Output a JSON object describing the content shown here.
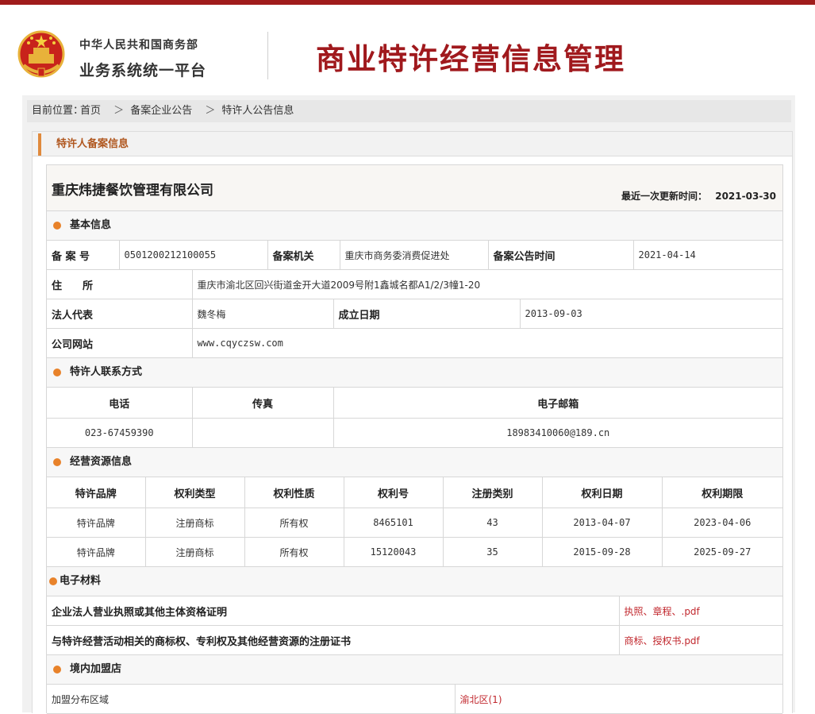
{
  "header": {
    "ministry_line1": "中华人民共和国商务部",
    "ministry_line2": "业务系统统一平台",
    "system_title": "商业特许经营信息管理"
  },
  "breadcrumb": {
    "prefix": "目前位置：",
    "items": [
      "首页",
      "备案企业公告",
      "特许人公告信息"
    ],
    "separator": "＞"
  },
  "panel": {
    "title": "特许人备案信息"
  },
  "company": {
    "name": "重庆炜捷餐饮管理有限公司",
    "last_update_label": "最近一次更新时间：",
    "last_update": "2021-03-30"
  },
  "basic": {
    "title": "基本信息",
    "record_no_label": "备 案 号",
    "record_no": "0501200212100055",
    "authority_label": "备案机关",
    "authority": "重庆市商务委消费促进处",
    "announce_label": "备案公告时间",
    "announce_date": "2021-04-14",
    "address_label": "住　　所",
    "address": "重庆市渝北区回兴街道金开大道2009号附1鑫城名都A1/2/3幢1-20",
    "legal_rep_label": "法人代表",
    "legal_rep": "魏冬梅",
    "founded_label": "成立日期",
    "founded": "2013-09-03",
    "website_label": "公司网站",
    "website": "www.cqyczsw.com"
  },
  "contact": {
    "title": "特许人联系方式",
    "headers": [
      "电话",
      "传真",
      "电子邮箱"
    ],
    "phone": "023-67459390",
    "fax": "",
    "email": "18983410060@189.cn"
  },
  "resources": {
    "title": "经营资源信息",
    "headers": [
      "特许品牌",
      "权利类型",
      "权利性质",
      "权利号",
      "注册类别",
      "权利日期",
      "权利期限"
    ],
    "rows": [
      [
        "特许品牌",
        "注册商标",
        "所有权",
        "8465101",
        "43",
        "2013-04-07",
        "2023-04-06"
      ],
      [
        "特许品牌",
        "注册商标",
        "所有权",
        "15120043",
        "35",
        "2015-09-28",
        "2025-09-27"
      ]
    ]
  },
  "materials": {
    "title": "电子材料",
    "rows": [
      {
        "label": "企业法人营业执照或其他主体资格证明",
        "file": "执照、章程、.pdf"
      },
      {
        "label": "与特许经营活动相关的商标权、专利权及其他经营资源的注册证书",
        "file": "商标、授权书.pdf"
      }
    ]
  },
  "stores": {
    "title": "境内加盟店",
    "region_label": "加盟分布区域",
    "region_value": "渝北区(1)"
  },
  "colors": {
    "brand_red": "#a0191d",
    "accent_orange": "#e8822a"
  }
}
